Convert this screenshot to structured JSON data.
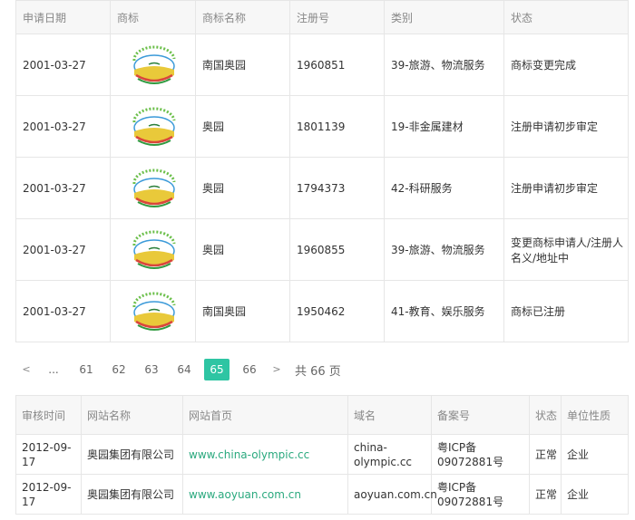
{
  "trademark_table": {
    "headers": [
      "申请日期",
      "商标",
      "商标名称",
      "注册号",
      "类别",
      "状态"
    ],
    "rows": [
      {
        "date": "2001-03-27",
        "logo": "wheat-logo-icon",
        "name": "南国奥园",
        "reg_no": "1960851",
        "category": "39-旅游、物流服务",
        "status": "商标变更完成"
      },
      {
        "date": "2001-03-27",
        "logo": "wheat-logo-icon",
        "name": "奥园",
        "reg_no": "1801139",
        "category": "19-非金属建材",
        "status": "注册申请初步审定"
      },
      {
        "date": "2001-03-27",
        "logo": "wheat-logo-icon",
        "name": "奥园",
        "reg_no": "1794373",
        "category": "42-科研服务",
        "status": "注册申请初步审定"
      },
      {
        "date": "2001-03-27",
        "logo": "wheat-logo-icon",
        "name": "奥园",
        "reg_no": "1960855",
        "category": "39-旅游、物流服务",
        "status": "变更商标申请人/注册人名义/地址中"
      },
      {
        "date": "2001-03-27",
        "logo": "wheat-logo-icon",
        "name": "南国奥园",
        "reg_no": "1950462",
        "category": "41-教育、娱乐服务",
        "status": "商标已注册"
      }
    ]
  },
  "pagination": {
    "prev": "<",
    "ellipsis": "...",
    "pages": [
      "61",
      "62",
      "63",
      "64",
      "65",
      "66"
    ],
    "current": "65",
    "next": ">",
    "total_text": "共 66 页"
  },
  "website_table": {
    "headers": [
      "审核时间",
      "网站名称",
      "网站首页",
      "域名",
      "备案号",
      "状态",
      "单位性质"
    ],
    "rows": [
      {
        "time": "2012-09-17",
        "site_name": "奥园集团有限公司",
        "homepage": "www.china-olympic.cc",
        "domain": "china-olympic.cc",
        "icp": "粤ICP备09072881号",
        "status": "正常",
        "org_type": "企业"
      },
      {
        "time": "2012-09-17",
        "site_name": "奥园集团有限公司",
        "homepage": "www.aoyuan.com.cn",
        "domain": "aoyuan.com.cn",
        "icp": "粤ICP备09072881号",
        "status": "正常",
        "org_type": "企业"
      }
    ]
  },
  "colors": {
    "accent": "#2ec5a3",
    "link": "#2aa97e",
    "header_bg": "#f7f7f7",
    "border": "#e6e6e6"
  }
}
